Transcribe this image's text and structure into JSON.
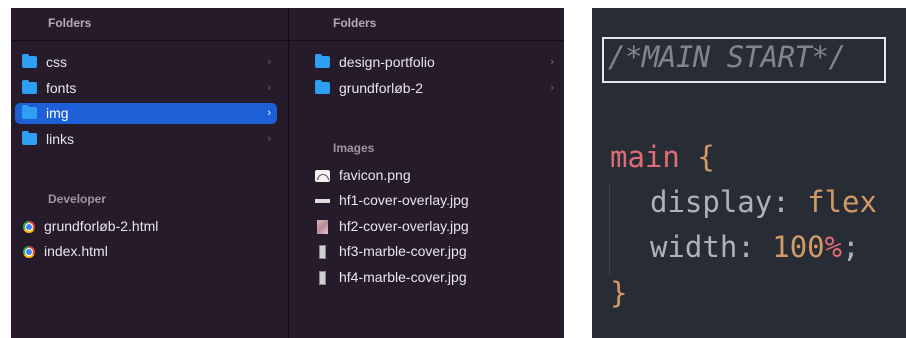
{
  "finder": {
    "col1": {
      "header": "Folders",
      "folders": [
        {
          "label": "css",
          "chevron": "›"
        },
        {
          "label": "fonts",
          "chevron": "›"
        },
        {
          "label": "img",
          "chevron": "›",
          "selected": true
        },
        {
          "label": "links",
          "chevron": "›"
        }
      ],
      "developer_title": "Developer",
      "developer_files": [
        {
          "label": "grundforløb-2.html",
          "icon": "chrome-icon"
        },
        {
          "label": "index.html",
          "icon": "chrome-icon"
        }
      ]
    },
    "col2": {
      "header": "Folders",
      "folders": [
        {
          "label": "design-portfolio",
          "chevron": "›"
        },
        {
          "label": "grundforløb-2",
          "chevron": "›"
        }
      ],
      "images_title": "Images",
      "images": [
        {
          "label": "favicon.png",
          "icon": "png-icon"
        },
        {
          "label": "hf1-cover-overlay.jpg",
          "icon": "image-thumb-icon"
        },
        {
          "label": "hf2-cover-overlay.jpg",
          "icon": "image-thumb-icon"
        },
        {
          "label": "hf3-marble-cover.jpg",
          "icon": "image-thumb-icon"
        },
        {
          "label": "hf4-marble-cover.jpg",
          "icon": "image-thumb-icon"
        }
      ]
    },
    "colors": {
      "background": "#261b2b",
      "selection": "#1d5fd6",
      "folder": "#2e9ff2"
    }
  },
  "code": {
    "comment": "/*MAIN START*/",
    "selector": "main",
    "open_brace": "{",
    "close_brace": "}",
    "declarations": [
      {
        "property": "display",
        "value": "flex"
      },
      {
        "property": "width",
        "number": "100",
        "unit": "%"
      }
    ],
    "colors": {
      "background": "#282c34",
      "comment": "#7f848e",
      "selector": "#e06c75",
      "value": "#d19a66"
    }
  }
}
